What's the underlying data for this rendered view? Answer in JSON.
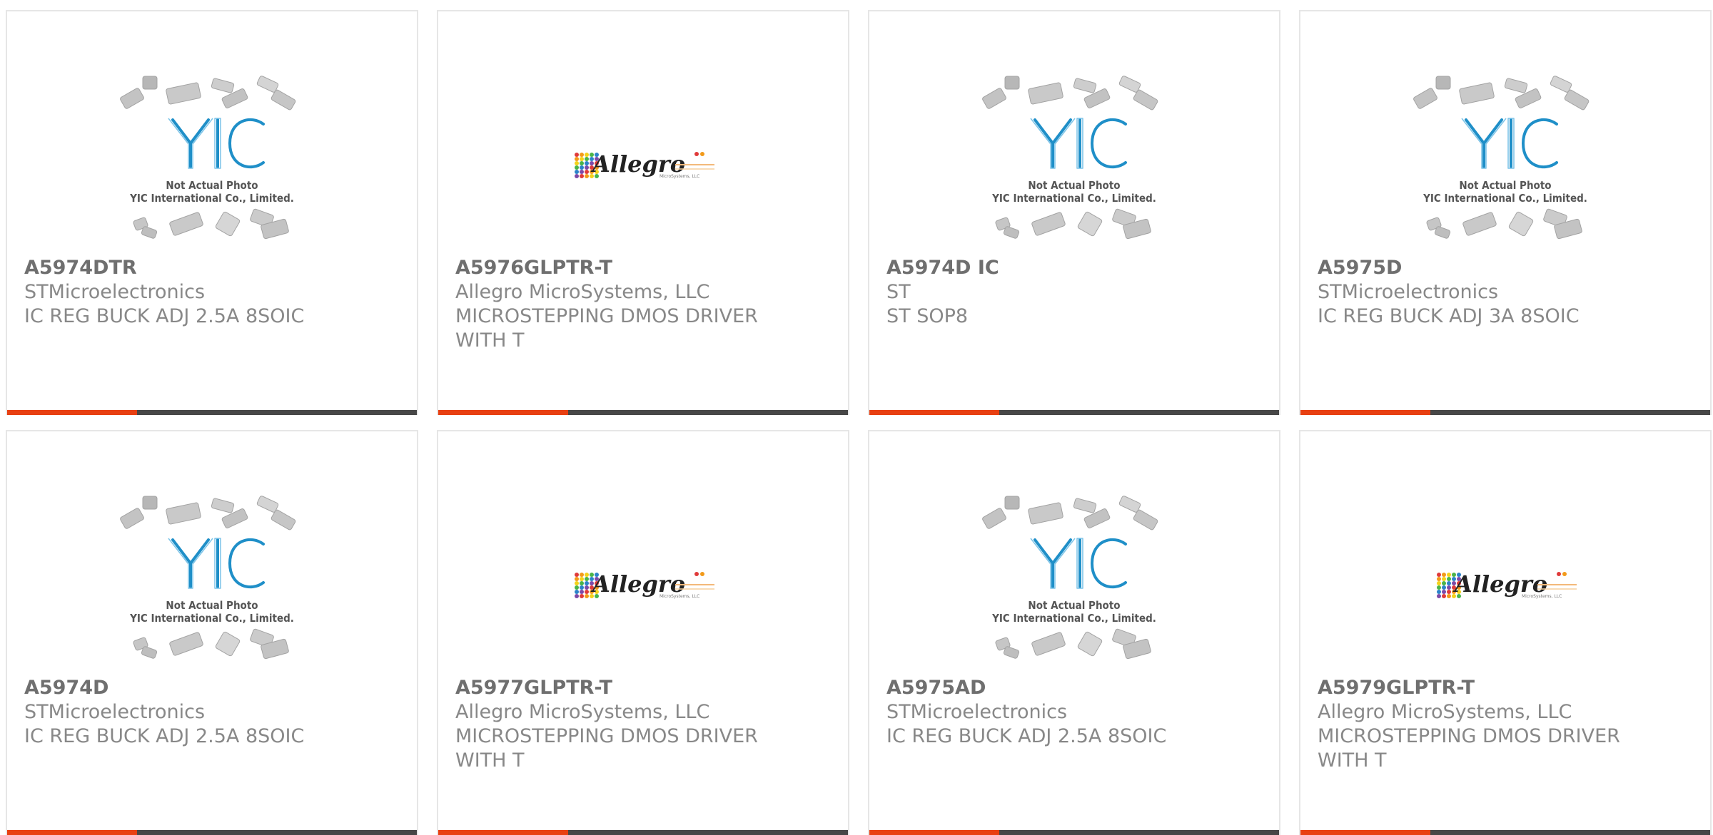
{
  "colors": {
    "accent": "#e84012",
    "bar": "#474747",
    "border": "#e6e6e6",
    "text": "#888888"
  },
  "placeholder": {
    "line1": "Not Actual Photo",
    "line2": "YIC International Co., Limited.",
    "logo_text": "YIC"
  },
  "allegro": {
    "brand": "Allegro",
    "sub": "MicroSystems, LLC"
  },
  "products": [
    {
      "part": "A5974DTR",
      "manufacturer": "STMicroelectronics",
      "description": "IC REG BUCK ADJ 2.5A 8SOIC",
      "image": "yic-placeholder"
    },
    {
      "part": "A5976GLPTR-T",
      "manufacturer": "Allegro MicroSystems, LLC",
      "description": "MICROSTEPPING DMOS DRIVER WITH T",
      "image": "allegro-logo"
    },
    {
      "part": "A5974D IC",
      "manufacturer": "ST",
      "description": "ST SOP8",
      "image": "yic-placeholder"
    },
    {
      "part": "A5975D",
      "manufacturer": "STMicroelectronics",
      "description": "IC REG BUCK ADJ 3A 8SOIC",
      "image": "yic-placeholder"
    },
    {
      "part": "A5974D",
      "manufacturer": "STMicroelectronics",
      "description": "IC REG BUCK ADJ 2.5A 8SOIC",
      "image": "yic-placeholder"
    },
    {
      "part": "A5977GLPTR-T",
      "manufacturer": "Allegro MicroSystems, LLC",
      "description": "MICROSTEPPING DMOS DRIVER WITH T",
      "image": "allegro-logo"
    },
    {
      "part": "A5975AD",
      "manufacturer": "STMicroelectronics",
      "description": "IC REG BUCK ADJ 2.5A 8SOIC",
      "image": "yic-placeholder"
    },
    {
      "part": "A5979GLPTR-T",
      "manufacturer": "Allegro MicroSystems, LLC",
      "description": "MICROSTEPPING DMOS DRIVER WITH T",
      "image": "allegro-logo"
    }
  ]
}
